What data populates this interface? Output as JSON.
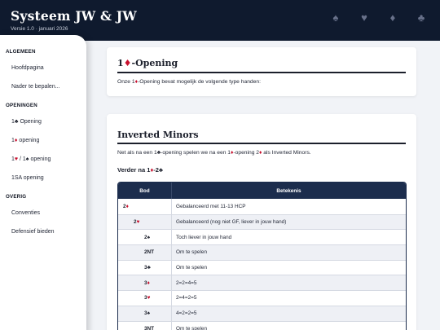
{
  "header": {
    "title": "Systeem JW & JW",
    "subtitle": "Versie 1.0 · januari 2026",
    "suits": [
      "♠",
      "♥",
      "♦",
      "♣"
    ]
  },
  "sidebar": {
    "sections": [
      {
        "label": "ALGEMEEN",
        "items": [
          "Hoofdpagina",
          "Nader te bepalen..."
        ]
      },
      {
        "label": "OPENINGEN",
        "items": [
          {
            "prefix": "1",
            "suit": "♣",
            "suit_color": "black",
            "rest": " Opening"
          },
          {
            "prefix": "1",
            "suit": "♦",
            "suit_color": "red",
            "rest": " opening"
          },
          {
            "prefix": "1",
            "suit": "♥",
            "suit_color": "red",
            "mid": " / 1",
            "suit2": "♠",
            "suit2_color": "black",
            "rest": " opening"
          },
          {
            "prefix": "1SA opening"
          }
        ]
      },
      {
        "label": "OVERIG",
        "items": [
          "Conventies",
          "Defensief bieden"
        ]
      }
    ]
  },
  "card1": {
    "title_prefix": "1",
    "title_suit": "♦",
    "title_rest": "-Opening",
    "text_a": "Onze 1",
    "text_suit": "♦",
    "text_b": "-Opening bevat mogelijk de volgende type handen:"
  },
  "card2": {
    "title": "Inverted Minors",
    "text_a": "Net als na een 1",
    "text_suit1": "♣",
    "text_b": "-opening spelen we na een 1",
    "text_suit2": "♦",
    "text_c": "-opening 2",
    "text_suit3": "♦",
    "text_d": " als Inverted Minors.",
    "sub_a": "Verder na 1",
    "sub_suit1": "♦",
    "sub_b": "-2",
    "sub_suit2": "♣",
    "table": {
      "col_bid": "Bod",
      "col_meaning": "Betekenis",
      "rows": [
        {
          "level": 0,
          "bid": "2",
          "suit": "♦",
          "suit_color": "red",
          "meaning": "Gebalanceerd met 11-13 HCP"
        },
        {
          "level": 1,
          "bid": "2",
          "suit": "♥",
          "suit_color": "red",
          "meaning": "Gebalanceerd (nog niet GF, liever in jouw hand)"
        },
        {
          "level": 2,
          "bid": "2",
          "suit": "♠",
          "suit_color": "black",
          "meaning": "Toch liever in jouw hand"
        },
        {
          "level": 2,
          "bid": "2NT",
          "suit": "",
          "suit_color": "black",
          "meaning": "Om te spelen"
        },
        {
          "level": 2,
          "bid": "3",
          "suit": "♣",
          "suit_color": "black",
          "meaning": "Om te spelen"
        },
        {
          "level": 2,
          "bid": "3",
          "suit": "♦",
          "suit_color": "red",
          "meaning": "2=2=4=5"
        },
        {
          "level": 2,
          "bid": "3",
          "suit": "♥",
          "suit_color": "red",
          "meaning": "2=4=2=5"
        },
        {
          "level": 2,
          "bid": "3",
          "suit": "♠",
          "suit_color": "black",
          "meaning": "4=2=2=5"
        },
        {
          "level": 2,
          "bid": "3NT",
          "suit": "",
          "suit_color": "black",
          "meaning": "Om te spelen"
        }
      ]
    }
  },
  "colors": {
    "header_bg": "#0f1a2e",
    "table_header_bg": "#1c2d4d",
    "suit_red": "#c8102e",
    "page_bg": "#f1f3f7"
  }
}
